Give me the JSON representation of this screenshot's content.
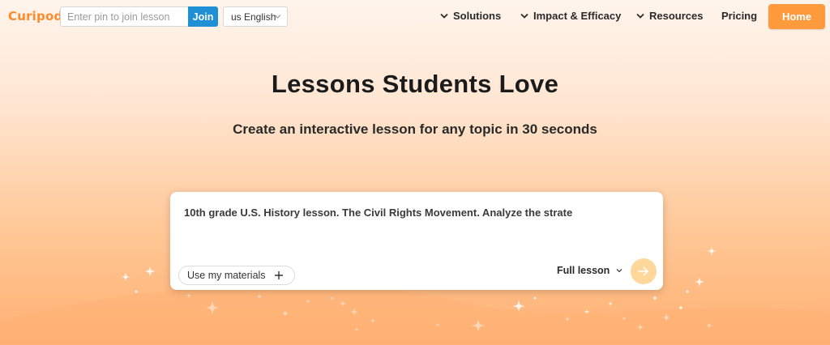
{
  "nav": {
    "logo_text": "Curipod",
    "pin_placeholder": "Enter pin to join lesson",
    "pin_value": "",
    "join_label": "Join",
    "language": "us English",
    "items": [
      {
        "label": "Solutions",
        "has_dropdown": true
      },
      {
        "label": "Impact & Efficacy",
        "has_dropdown": true
      },
      {
        "label": "Resources",
        "has_dropdown": true
      },
      {
        "label": "Pricing",
        "has_dropdown": false
      }
    ],
    "home_label": "Home"
  },
  "hero": {
    "title": "Lessons Students Love",
    "subtitle": "Create an interactive lesson for any topic in 30 seconds"
  },
  "prompt_card": {
    "text": "10th grade U.S. History lesson. The Civil Rights Movement. Analyze the strate",
    "materials_label": "Use my materials",
    "lesson_type": "Full lesson"
  },
  "colors": {
    "accent": "#ff9a3d",
    "join_blue": "#1f8fd6",
    "send_button": "#ffd79a"
  },
  "icons": [
    "chevron-down-icon",
    "plus-icon",
    "arrow-right-icon",
    "sparkle-icon"
  ]
}
